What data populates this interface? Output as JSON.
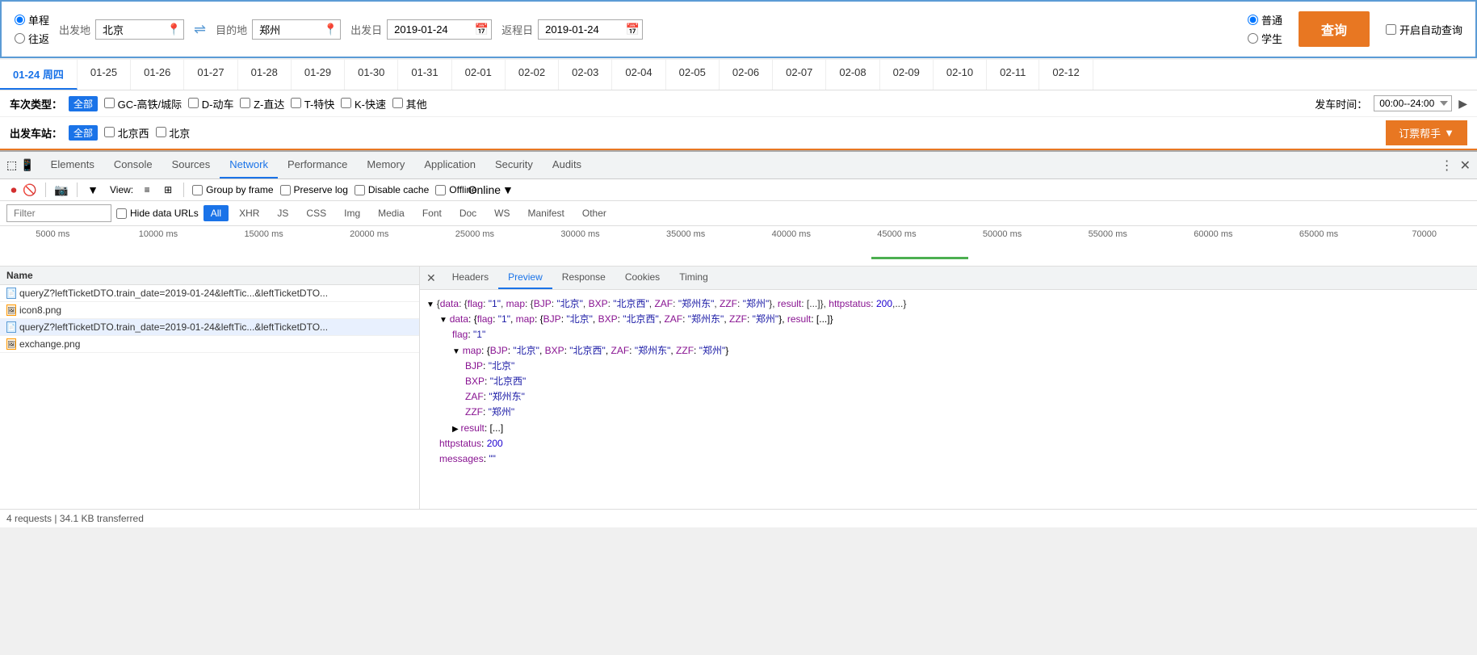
{
  "booking": {
    "trip_types": [
      "单程",
      "往返"
    ],
    "trip_selected": "单程",
    "from_label": "出发地",
    "from_value": "北京",
    "to_label": "目的地",
    "to_value": "郑州",
    "depart_label": "出发日",
    "depart_value": "2019-01-24",
    "return_label": "返程日",
    "return_value": "2019-01-24",
    "ticket_types": [
      "普通",
      "学生"
    ],
    "ticket_selected": "普通",
    "auto_query_label": "开启自动查询",
    "query_btn_label": "查询"
  },
  "date_nav": {
    "items": [
      {
        "label": "01-24 周四",
        "active": true
      },
      {
        "label": "01-25"
      },
      {
        "label": "01-26"
      },
      {
        "label": "01-27"
      },
      {
        "label": "01-28"
      },
      {
        "label": "01-29"
      },
      {
        "label": "01-30"
      },
      {
        "label": "01-31"
      },
      {
        "label": "02-01"
      },
      {
        "label": "02-02"
      },
      {
        "label": "02-03"
      },
      {
        "label": "02-04"
      },
      {
        "label": "02-05"
      },
      {
        "label": "02-06"
      },
      {
        "label": "02-07"
      },
      {
        "label": "02-08"
      },
      {
        "label": "02-09"
      },
      {
        "label": "02-10"
      },
      {
        "label": "02-11"
      },
      {
        "label": "02-12"
      }
    ]
  },
  "train_filter": {
    "type_label": "车次类型：",
    "all_label": "全部",
    "types": [
      "GC-高铁/城际",
      "D-动车",
      "Z-直达",
      "T-特快",
      "K-快速",
      "其他"
    ],
    "station_label": "出发车站：",
    "station_all": "全部",
    "stations": [
      "北京西",
      "北京"
    ],
    "time_label": "发车时间：",
    "time_value": "00:00--24:00",
    "ticket_assist_label": "订票帮手"
  },
  "devtools": {
    "tabs": [
      "Elements",
      "Console",
      "Sources",
      "Network",
      "Performance",
      "Memory",
      "Application",
      "Security",
      "Audits"
    ],
    "active_tab": "Network",
    "toolbar": {
      "record_tooltip": "Record",
      "clear_tooltip": "Clear",
      "capture_tooltip": "Capture screenshots",
      "filter_tooltip": "Filter",
      "view_label": "View:",
      "group_by_frame": "Group by frame",
      "preserve_log": "Preserve log",
      "disable_cache": "Disable cache",
      "offline_label": "Offline",
      "online_label": "Online"
    },
    "filter_bar": {
      "placeholder": "Filter",
      "hide_data_urls": "Hide data URLs",
      "tags": [
        "All",
        "XHR",
        "JS",
        "CSS",
        "Img",
        "Media",
        "Font",
        "Doc",
        "WS",
        "Manifest",
        "Other"
      ]
    },
    "timeline": {
      "labels": [
        "5000 ms",
        "10000 ms",
        "15000 ms",
        "20000 ms",
        "25000 ms",
        "30000 ms",
        "35000 ms",
        "40000 ms",
        "45000 ms",
        "50000 ms",
        "55000 ms",
        "60000 ms",
        "65000 ms",
        "70000"
      ]
    },
    "network_list": {
      "header": "Name",
      "rows": [
        {
          "name": "queryZ?leftTicketDTO.train_date=2019-01-24&leftTic...&leftTicketDTO...",
          "icon": "doc"
        },
        {
          "name": "icon8.png",
          "icon": "img"
        },
        {
          "name": "queryZ?leftTicketDTO.train_date=2019-01-24&leftTic...&leftTicketDTO...",
          "icon": "doc"
        },
        {
          "name": "exchange.png",
          "icon": "img"
        }
      ]
    },
    "preview_panel": {
      "close_btn": "×",
      "tabs": [
        "Headers",
        "Preview",
        "Response",
        "Cookies",
        "Timing"
      ],
      "active_tab": "Preview",
      "content": {
        "line1": "{data: {flag: \"1\", map: {BJP: \"北京\", BXP: \"北京西\", ZAF: \"郑州东\", ZZF: \"郑州\"}, result: [...]}, httpstatus: 200,...}",
        "line2": "▼ data: {flag: \"1\", map: {BJP: \"北京\", BXP: \"北京西\", ZAF: \"郑州东\", ZZF: \"郑州\"}, result: [...]}",
        "line3": "flag: \"1\"",
        "line4": "▼ map: {BJP: \"北京\", BXP: \"北京西\", ZAF: \"郑州东\", ZZF: \"郑州\"}",
        "line5_key": "BJP:",
        "line5_val": "\"北京\"",
        "line6_key": "BXP:",
        "line6_val": "\"北京西\"",
        "line7_key": "ZAF:",
        "line7_val": "\"郑州东\"",
        "line8_key": "ZZF:",
        "line8_val": "\"郑州\"",
        "line9": "▶ result: [...]",
        "line10_key": "httpstatus:",
        "line10_val": "200",
        "line11_key": "messages:",
        "line11_val": "\"\""
      }
    },
    "status_bar": "4 requests | 34.1 KB transferred"
  }
}
